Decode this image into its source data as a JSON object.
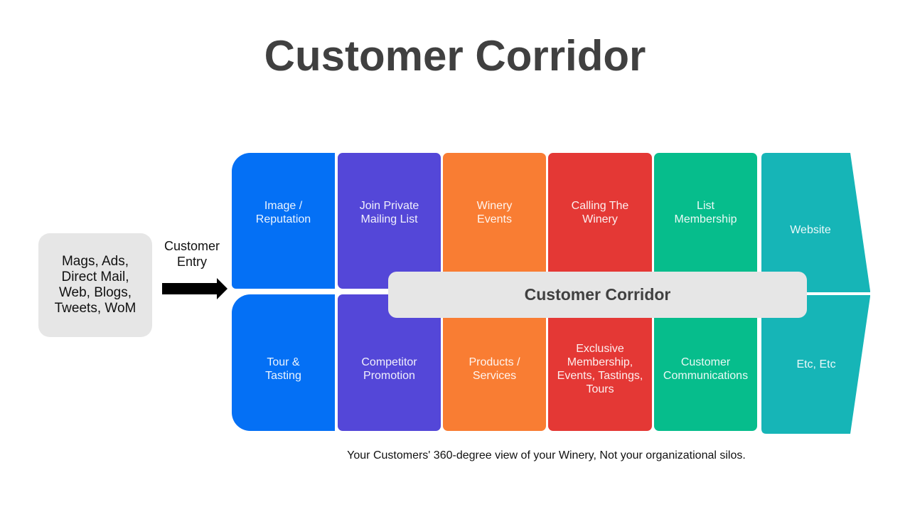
{
  "title": "Customer Corridor",
  "source": {
    "text": "Mags, Ads,\nDirect Mail,\nWeb, Blogs,\nTweets, WoM"
  },
  "entry": {
    "label": "Customer\nEntry",
    "arrow_icon": "right-arrow-icon"
  },
  "colors": {
    "blue": "#0470f5",
    "purple": "#5447d8",
    "orange": "#f97d33",
    "red": "#e43835",
    "green": "#06bd8c",
    "teal": "#16b5b7",
    "banner": "#e6e6e6",
    "title": "#404040"
  },
  "grid": {
    "top_row": [
      "Image /\nReputation",
      "Join Private\nMailing List",
      "Winery\nEvents",
      "Calling The\nWinery",
      "List\nMembership",
      "Website"
    ],
    "bottom_row": [
      "Tour &\nTasting",
      "Competitor\nPromotion",
      "Products /\nServices",
      "Exclusive\nMembership,\nEvents, Tastings,\nTours",
      "Customer\nCommunications",
      "Etc, Etc"
    ]
  },
  "banner": {
    "label": "Customer Corridor"
  },
  "footer": "Your Customers' 360-degree view of your Winery, Not your organizational silos."
}
